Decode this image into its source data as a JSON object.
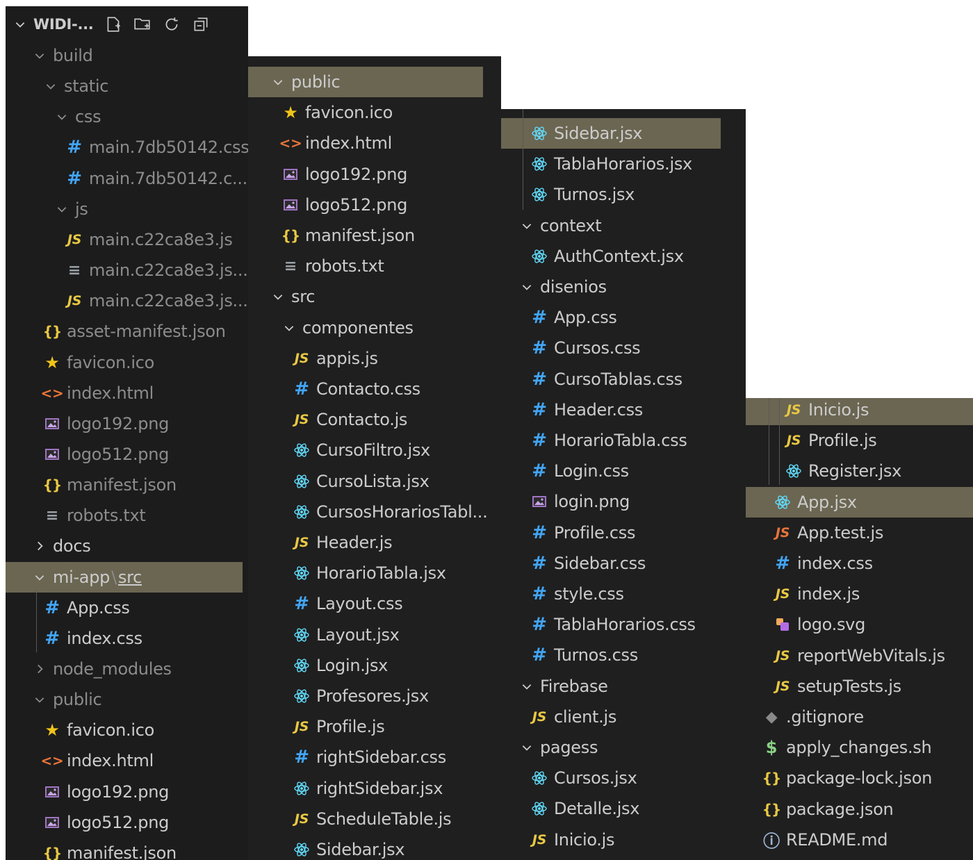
{
  "explorer": {
    "root_label": "WIDI-...",
    "toolbar": [
      "new-file-icon",
      "new-folder-icon",
      "refresh-icon",
      "collapse-all-icon"
    ]
  },
  "panel1": [
    {
      "label": "build",
      "kind": "folder-open",
      "indent": 1,
      "dim": true
    },
    {
      "label": "static",
      "kind": "folder-open",
      "indent": 2,
      "dim": true
    },
    {
      "label": "css",
      "kind": "folder-open",
      "indent": 3,
      "dim": true
    },
    {
      "label": "main.7db50142.css",
      "kind": "css",
      "indent": 4,
      "dim": true
    },
    {
      "label": "main.7db50142.c...",
      "kind": "css",
      "indent": 4,
      "dim": true
    },
    {
      "label": "js",
      "kind": "folder-open",
      "indent": 3,
      "dim": true
    },
    {
      "label": "main.c22ca8e3.js",
      "kind": "js",
      "indent": 4,
      "dim": true
    },
    {
      "label": "main.c22ca8e3.js....",
      "kind": "txt",
      "indent": 4,
      "dim": true
    },
    {
      "label": "main.c22ca8e3.js....",
      "kind": "js",
      "indent": 4,
      "dim": true
    },
    {
      "label": "asset-manifest.json",
      "kind": "json",
      "indent": 2,
      "dim": true
    },
    {
      "label": "favicon.ico",
      "kind": "star",
      "indent": 2,
      "dim": true
    },
    {
      "label": "index.html",
      "kind": "html",
      "indent": 2,
      "dim": true
    },
    {
      "label": "logo192.png",
      "kind": "img",
      "indent": 2,
      "dim": true
    },
    {
      "label": "logo512.png",
      "kind": "img",
      "indent": 2,
      "dim": true
    },
    {
      "label": "manifest.json",
      "kind": "json",
      "indent": 2,
      "dim": true
    },
    {
      "label": "robots.txt",
      "kind": "txt",
      "indent": 2,
      "dim": true
    },
    {
      "label": "docs",
      "kind": "folder-closed",
      "indent": 1,
      "dim": false
    },
    {
      "label": "mi-app",
      "sep": "\\",
      "label2": "src",
      "kind": "folder-open",
      "indent": 1,
      "dim": false,
      "selected": true
    },
    {
      "label": "App.css",
      "kind": "css",
      "indent": 2,
      "dim": false
    },
    {
      "label": "index.css",
      "kind": "css",
      "indent": 2,
      "dim": false
    },
    {
      "label": "node_modules",
      "kind": "folder-closed",
      "indent": 1,
      "dim": true
    },
    {
      "label": "public",
      "kind": "folder-open",
      "indent": 1,
      "dim": true
    },
    {
      "label": "favicon.ico",
      "kind": "star",
      "indent": 2,
      "dim": false
    },
    {
      "label": "index.html",
      "kind": "html",
      "indent": 2,
      "dim": false
    },
    {
      "label": "logo192.png",
      "kind": "img",
      "indent": 2,
      "dim": false
    },
    {
      "label": "logo512.png",
      "kind": "img",
      "indent": 2,
      "dim": false
    },
    {
      "label": "manifest.json",
      "kind": "json",
      "indent": 2,
      "dim": false
    }
  ],
  "panel2": [
    {
      "label": "public",
      "kind": "folder-open",
      "indent": 1,
      "dim": false,
      "selected": true
    },
    {
      "label": "favicon.ico",
      "kind": "star",
      "indent": 2
    },
    {
      "label": "index.html",
      "kind": "html",
      "indent": 2
    },
    {
      "label": "logo192.png",
      "kind": "img",
      "indent": 2
    },
    {
      "label": "logo512.png",
      "kind": "img",
      "indent": 2
    },
    {
      "label": "manifest.json",
      "kind": "json",
      "indent": 2
    },
    {
      "label": "robots.txt",
      "kind": "txt",
      "indent": 2
    },
    {
      "label": "src",
      "kind": "folder-open",
      "indent": 1
    },
    {
      "label": "componentes",
      "kind": "folder-open",
      "indent": 2
    },
    {
      "label": "appis.js",
      "kind": "js",
      "indent": 3
    },
    {
      "label": "Contacto.css",
      "kind": "css",
      "indent": 3
    },
    {
      "label": "Contacto.js",
      "kind": "js",
      "indent": 3
    },
    {
      "label": "CursoFiltro.jsx",
      "kind": "react",
      "indent": 3
    },
    {
      "label": "CursoLista.jsx",
      "kind": "react",
      "indent": 3
    },
    {
      "label": "CursosHorariosTabl...",
      "kind": "react",
      "indent": 3
    },
    {
      "label": "Header.js",
      "kind": "js",
      "indent": 3
    },
    {
      "label": "HorarioTabla.jsx",
      "kind": "react",
      "indent": 3
    },
    {
      "label": "Layout.css",
      "kind": "css",
      "indent": 3
    },
    {
      "label": "Layout.jsx",
      "kind": "react",
      "indent": 3
    },
    {
      "label": "Login.jsx",
      "kind": "react",
      "indent": 3
    },
    {
      "label": "Profesores.jsx",
      "kind": "react",
      "indent": 3
    },
    {
      "label": "Profile.js",
      "kind": "js",
      "indent": 3
    },
    {
      "label": "rightSidebar.css",
      "kind": "css",
      "indent": 3
    },
    {
      "label": "rightSidebar.jsx",
      "kind": "react",
      "indent": 3
    },
    {
      "label": "ScheduleTable.js",
      "kind": "js",
      "indent": 3
    },
    {
      "label": "Sidebar.jsx",
      "kind": "react",
      "indent": 3
    }
  ],
  "panel3": [
    {
      "label": "Sidebar.jsx",
      "kind": "react",
      "indent": 2,
      "selected": true
    },
    {
      "label": "TablaHorarios.jsx",
      "kind": "react",
      "indent": 2
    },
    {
      "label": "Turnos.jsx",
      "kind": "react",
      "indent": 2
    },
    {
      "label": "context",
      "kind": "folder-open",
      "indent": 1
    },
    {
      "label": "AuthContext.jsx",
      "kind": "react",
      "indent": 2
    },
    {
      "label": "disenios",
      "kind": "folder-open",
      "indent": 1
    },
    {
      "label": "App.css",
      "kind": "css",
      "indent": 2
    },
    {
      "label": "Cursos.css",
      "kind": "css",
      "indent": 2
    },
    {
      "label": "CursoTablas.css",
      "kind": "css",
      "indent": 2
    },
    {
      "label": "Header.css",
      "kind": "css",
      "indent": 2
    },
    {
      "label": "HorarioTabla.css",
      "kind": "css",
      "indent": 2
    },
    {
      "label": "Login.css",
      "kind": "css",
      "indent": 2
    },
    {
      "label": "login.png",
      "kind": "img",
      "indent": 2
    },
    {
      "label": "Profile.css",
      "kind": "css",
      "indent": 2
    },
    {
      "label": "Sidebar.css",
      "kind": "css",
      "indent": 2
    },
    {
      "label": "style.css",
      "kind": "css",
      "indent": 2
    },
    {
      "label": "TablaHorarios.css",
      "kind": "css",
      "indent": 2
    },
    {
      "label": "Turnos.css",
      "kind": "css",
      "indent": 2
    },
    {
      "label": "Firebase",
      "kind": "folder-open",
      "indent": 1
    },
    {
      "label": "client.js",
      "kind": "js",
      "indent": 2
    },
    {
      "label": "pagess",
      "kind": "folder-open",
      "indent": 1
    },
    {
      "label": "Cursos.jsx",
      "kind": "react",
      "indent": 2
    },
    {
      "label": "Detalle.jsx",
      "kind": "react",
      "indent": 2
    },
    {
      "label": "Inicio.js",
      "kind": "js",
      "indent": 2
    }
  ],
  "panel4": [
    {
      "label": "Inicio.js",
      "kind": "js",
      "indent": 3,
      "selected": true
    },
    {
      "label": "Profile.js",
      "kind": "js",
      "indent": 3
    },
    {
      "label": "Register.jsx",
      "kind": "react",
      "indent": 3
    },
    {
      "label": "App.jsx",
      "kind": "react",
      "indent": 2,
      "selected": true
    },
    {
      "label": "App.test.js",
      "kind": "jsr",
      "indent": 2
    },
    {
      "label": "index.css",
      "kind": "css",
      "indent": 2
    },
    {
      "label": "index.js",
      "kind": "js",
      "indent": 2
    },
    {
      "label": "logo.svg",
      "kind": "svg",
      "indent": 2
    },
    {
      "label": "reportWebVitals.js",
      "kind": "js",
      "indent": 2
    },
    {
      "label": "setupTests.js",
      "kind": "js",
      "indent": 2
    },
    {
      "label": ".gitignore",
      "kind": "git",
      "indent": 1
    },
    {
      "label": "apply_changes.sh",
      "kind": "dollar",
      "indent": 1
    },
    {
      "label": "package-lock.json",
      "kind": "json",
      "indent": 1
    },
    {
      "label": "package.json",
      "kind": "json",
      "indent": 1
    },
    {
      "label": "README.md",
      "kind": "info",
      "indent": 1
    }
  ],
  "colors": {
    "background": "#1f1f1f",
    "selected_row": "#6b6652",
    "text": "#cccccc",
    "dim_text": "#8c8c8c",
    "js_icon": "#e8c844",
    "css_icon": "#42a5f5",
    "react_icon": "#61dafb"
  }
}
